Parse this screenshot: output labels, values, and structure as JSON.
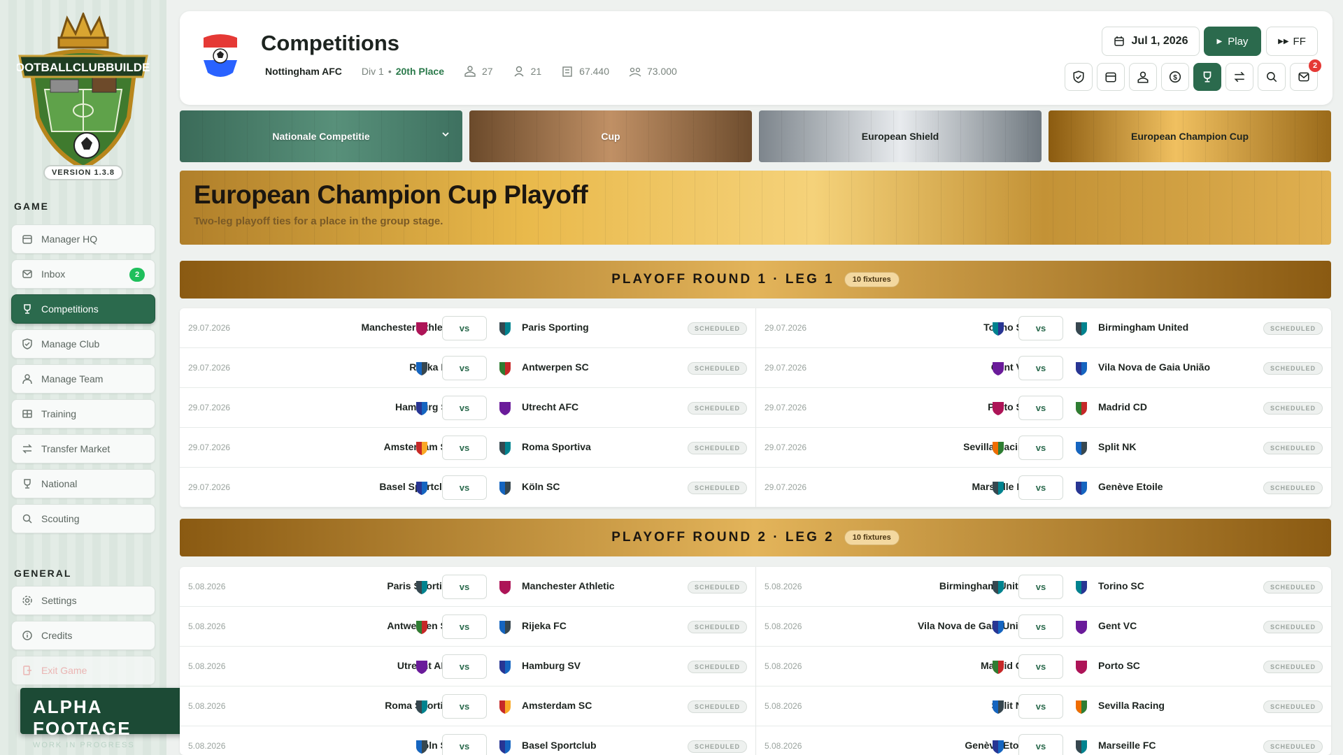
{
  "sidebar": {
    "logo_text": "FOOTBALLCLUBBUILDER",
    "version": "VERSION 1.3.8",
    "game_title": "GAME",
    "general_title": "GENERAL",
    "game_items": [
      {
        "label": "Manager HQ",
        "icon": "calendar-icon"
      },
      {
        "label": "Inbox",
        "icon": "mail-icon",
        "badge": "2"
      },
      {
        "label": "Competitions",
        "icon": "trophy-icon",
        "active": true
      },
      {
        "label": "Manage Club",
        "icon": "shield-icon"
      },
      {
        "label": "Manage Team",
        "icon": "team-icon"
      },
      {
        "label": "Training",
        "icon": "training-icon"
      },
      {
        "label": "Transfer Market",
        "icon": "transfer-icon"
      },
      {
        "label": "National",
        "icon": "trophy-icon"
      },
      {
        "label": "Scouting",
        "icon": "search-icon"
      }
    ],
    "general_items": [
      {
        "label": "Settings",
        "icon": "gear-icon"
      },
      {
        "label": "Credits",
        "icon": "info-icon"
      },
      {
        "label": "Exit Game",
        "icon": "exit-icon"
      }
    ],
    "alpha": {
      "title": "ALPHA FOOTAGE",
      "subtitle": "WORK IN PROGRESS"
    }
  },
  "header": {
    "title": "Competitions",
    "club_name": "Nottingham AFC",
    "division": "Div 1",
    "place": "20th Place",
    "stats": [
      {
        "icon": "players-icon",
        "value": "27"
      },
      {
        "icon": "staff-icon",
        "value": "21"
      },
      {
        "icon": "stadium-icon",
        "value": "67.440"
      },
      {
        "icon": "fans-icon",
        "value": "73.000"
      }
    ],
    "date": "Jul 1, 2026",
    "play_label": "Play",
    "ff_label": "FF",
    "mail_badge": "2"
  },
  "tabs": [
    {
      "label": "Nationale Competitie"
    },
    {
      "label": "Cup"
    },
    {
      "label": "European Shield"
    },
    {
      "label": "European Champion Cup"
    }
  ],
  "banner": {
    "title": "European Champion Cup Playoff",
    "subtitle": "Two-leg playoff ties for a place in the group stage."
  },
  "rounds": [
    {
      "title": "PLAYOFF ROUND 1 · LEG 1",
      "count": "10 fixtures",
      "left": [
        {
          "date": "29.07.2026",
          "home": "Manchester Athletic",
          "away": "Paris Sporting",
          "status": "SCHEDULED"
        },
        {
          "date": "29.07.2026",
          "home": "Rijeka FC",
          "away": "Antwerpen SC",
          "status": "SCHEDULED"
        },
        {
          "date": "29.07.2026",
          "home": "Hamburg SV",
          "away": "Utrecht AFC",
          "status": "SCHEDULED"
        },
        {
          "date": "29.07.2026",
          "home": "Amsterdam SC",
          "away": "Roma Sportiva",
          "status": "SCHEDULED"
        },
        {
          "date": "29.07.2026",
          "home": "Basel Sportclub",
          "away": "Köln SC",
          "status": "SCHEDULED"
        }
      ],
      "right": [
        {
          "date": "29.07.2026",
          "home": "Torino SC",
          "away": "Birmingham United",
          "status": "SCHEDULED"
        },
        {
          "date": "29.07.2026",
          "home": "Gent VC",
          "away": "Vila Nova de Gaia União",
          "status": "SCHEDULED"
        },
        {
          "date": "29.07.2026",
          "home": "Porto SC",
          "away": "Madrid CD",
          "status": "SCHEDULED"
        },
        {
          "date": "29.07.2026",
          "home": "Sevilla Racing",
          "away": "Split NK",
          "status": "SCHEDULED"
        },
        {
          "date": "29.07.2026",
          "home": "Marseille FC",
          "away": "Genève Etoile",
          "status": "SCHEDULED"
        }
      ]
    },
    {
      "title": "PLAYOFF ROUND 2 · LEG 2",
      "count": "10 fixtures",
      "left": [
        {
          "date": "5.08.2026",
          "home": "Paris Sporting",
          "away": "Manchester Athletic",
          "status": "SCHEDULED"
        },
        {
          "date": "5.08.2026",
          "home": "Antwerpen SC",
          "away": "Rijeka FC",
          "status": "SCHEDULED"
        },
        {
          "date": "5.08.2026",
          "home": "Utrecht AFC",
          "away": "Hamburg SV",
          "status": "SCHEDULED"
        },
        {
          "date": "5.08.2026",
          "home": "Roma Sportiva",
          "away": "Amsterdam SC",
          "status": "SCHEDULED"
        },
        {
          "date": "5.08.2026",
          "home": "Köln SC",
          "away": "Basel Sportclub",
          "status": "SCHEDULED"
        }
      ],
      "right": [
        {
          "date": "5.08.2026",
          "home": "Birmingham United",
          "away": "Torino SC",
          "status": "SCHEDULED"
        },
        {
          "date": "5.08.2026",
          "home": "Vila Nova de Gaia União",
          "away": "Gent VC",
          "status": "SCHEDULED"
        },
        {
          "date": "5.08.2026",
          "home": "Madrid CD",
          "away": "Porto SC",
          "status": "SCHEDULED"
        },
        {
          "date": "5.08.2026",
          "home": "Split NK",
          "away": "Sevilla Racing",
          "status": "SCHEDULED"
        },
        {
          "date": "5.08.2026",
          "home": "Genève Etoile",
          "away": "Marseille FC",
          "status": "SCHEDULED"
        }
      ]
    }
  ],
  "vs_label": "vs",
  "colors": {
    "brand_green": "#2b6a4d",
    "gold": "#e3b45a",
    "badge_green": "#1fbf5c",
    "notif_red": "#e53935"
  }
}
